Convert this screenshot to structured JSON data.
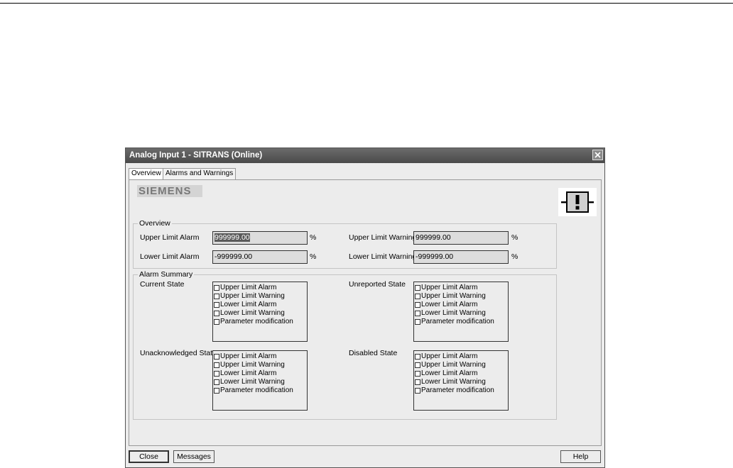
{
  "window": {
    "title": "Analog Input 1 - SITRANS  (Online)"
  },
  "tabs": [
    {
      "label": "Overview",
      "active": true
    },
    {
      "label": "Alarms and Warnings",
      "active": false
    }
  ],
  "logo": {
    "text": "SIEMENS"
  },
  "alert_icon": "exclamation-block-icon",
  "overview": {
    "label": "Overview",
    "upper_limit_alarm": {
      "label": "Upper Limit Alarm",
      "value": "999999.00",
      "unit": "%"
    },
    "lower_limit_alarm": {
      "label": "Lower Limit Alarm",
      "value": "-999999.00",
      "unit": "%"
    },
    "upper_limit_warning": {
      "label": "Upper Limit Warning",
      "value": "999999.00",
      "unit": "%"
    },
    "lower_limit_warning": {
      "label": "Lower Limit Warning",
      "value": "-999999.00",
      "unit": "%"
    }
  },
  "alarm_summary": {
    "label": "Alarm Summary",
    "item_labels": [
      "Upper Limit Alarm",
      "Upper Limit Warning",
      "Lower Limit Alarm",
      "Lower Limit Warning",
      "Parameter modification"
    ],
    "current_state": {
      "label": "Current State"
    },
    "unreported_state": {
      "label": "Unreported State"
    },
    "unacknowledged_state": {
      "label": "Unacknowledged State"
    },
    "disabled_state": {
      "label": "Disabled State"
    }
  },
  "buttons": {
    "close": "Close",
    "messages": "Messages",
    "help": "Help"
  },
  "colors": {
    "titlebar": "#555555",
    "panel": "#ececec",
    "selection": "#5a5a5a"
  }
}
